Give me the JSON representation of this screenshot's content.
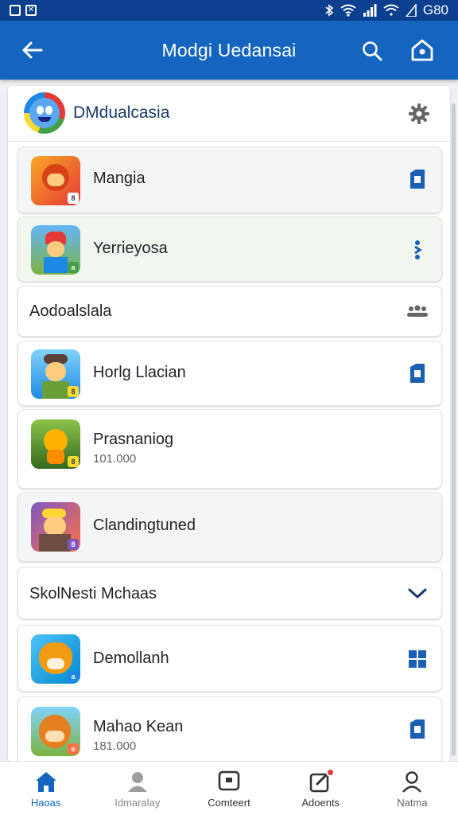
{
  "colors": {
    "primary": "#1565c0",
    "status_bar": "#0b3f8f",
    "accent_icon": "#1a5fb4",
    "notification": "#e53935"
  },
  "status_bar": {
    "left_icons": [
      "square-icon",
      "x-box-icon"
    ],
    "right_icons": [
      "bluetooth-icon",
      "wifi-icon",
      "signal-icon",
      "wifi-icon",
      "signal-icon"
    ],
    "right_text": "G80"
  },
  "header": {
    "title": "Modgi Uedansai",
    "back_icon": "arrow-left-icon",
    "search_icon": "search-icon",
    "home_icon": "home-icon"
  },
  "profile": {
    "name": "DMdualcasia",
    "settings_icon": "gear-icon"
  },
  "items": [
    {
      "title": "Mangia",
      "action_icon": "save-icon"
    },
    {
      "title": "Yerrieyosa",
      "action_icon": "more-vertical-icon"
    }
  ],
  "section1": {
    "title": "Aodoalslala",
    "action_icon": "group-icon"
  },
  "items2": [
    {
      "title": "Horlg Llacian",
      "action_icon": "save-icon"
    },
    {
      "title": "Prasnaniog",
      "subtitle": "101.000"
    },
    {
      "title": "Clandingtuned"
    }
  ],
  "section2": {
    "title": "SkolNesti Mchaas",
    "action_icon": "chevron-down-icon"
  },
  "items3": [
    {
      "title": "Demollanh",
      "action_icon": "grid-icon"
    },
    {
      "title": "Mahao Kean",
      "subtitle": "181.000",
      "action_icon": "save-icon"
    }
  ],
  "nav": [
    {
      "label": "Haoas",
      "icon": "home-icon",
      "active": true
    },
    {
      "label": "Idmaralay",
      "icon": "profile-icon"
    },
    {
      "label": "Comteert",
      "icon": "chat-icon"
    },
    {
      "label": "Adoents",
      "icon": "edit-icon",
      "badge": true
    },
    {
      "label": "Natma",
      "icon": "user-icon"
    }
  ]
}
